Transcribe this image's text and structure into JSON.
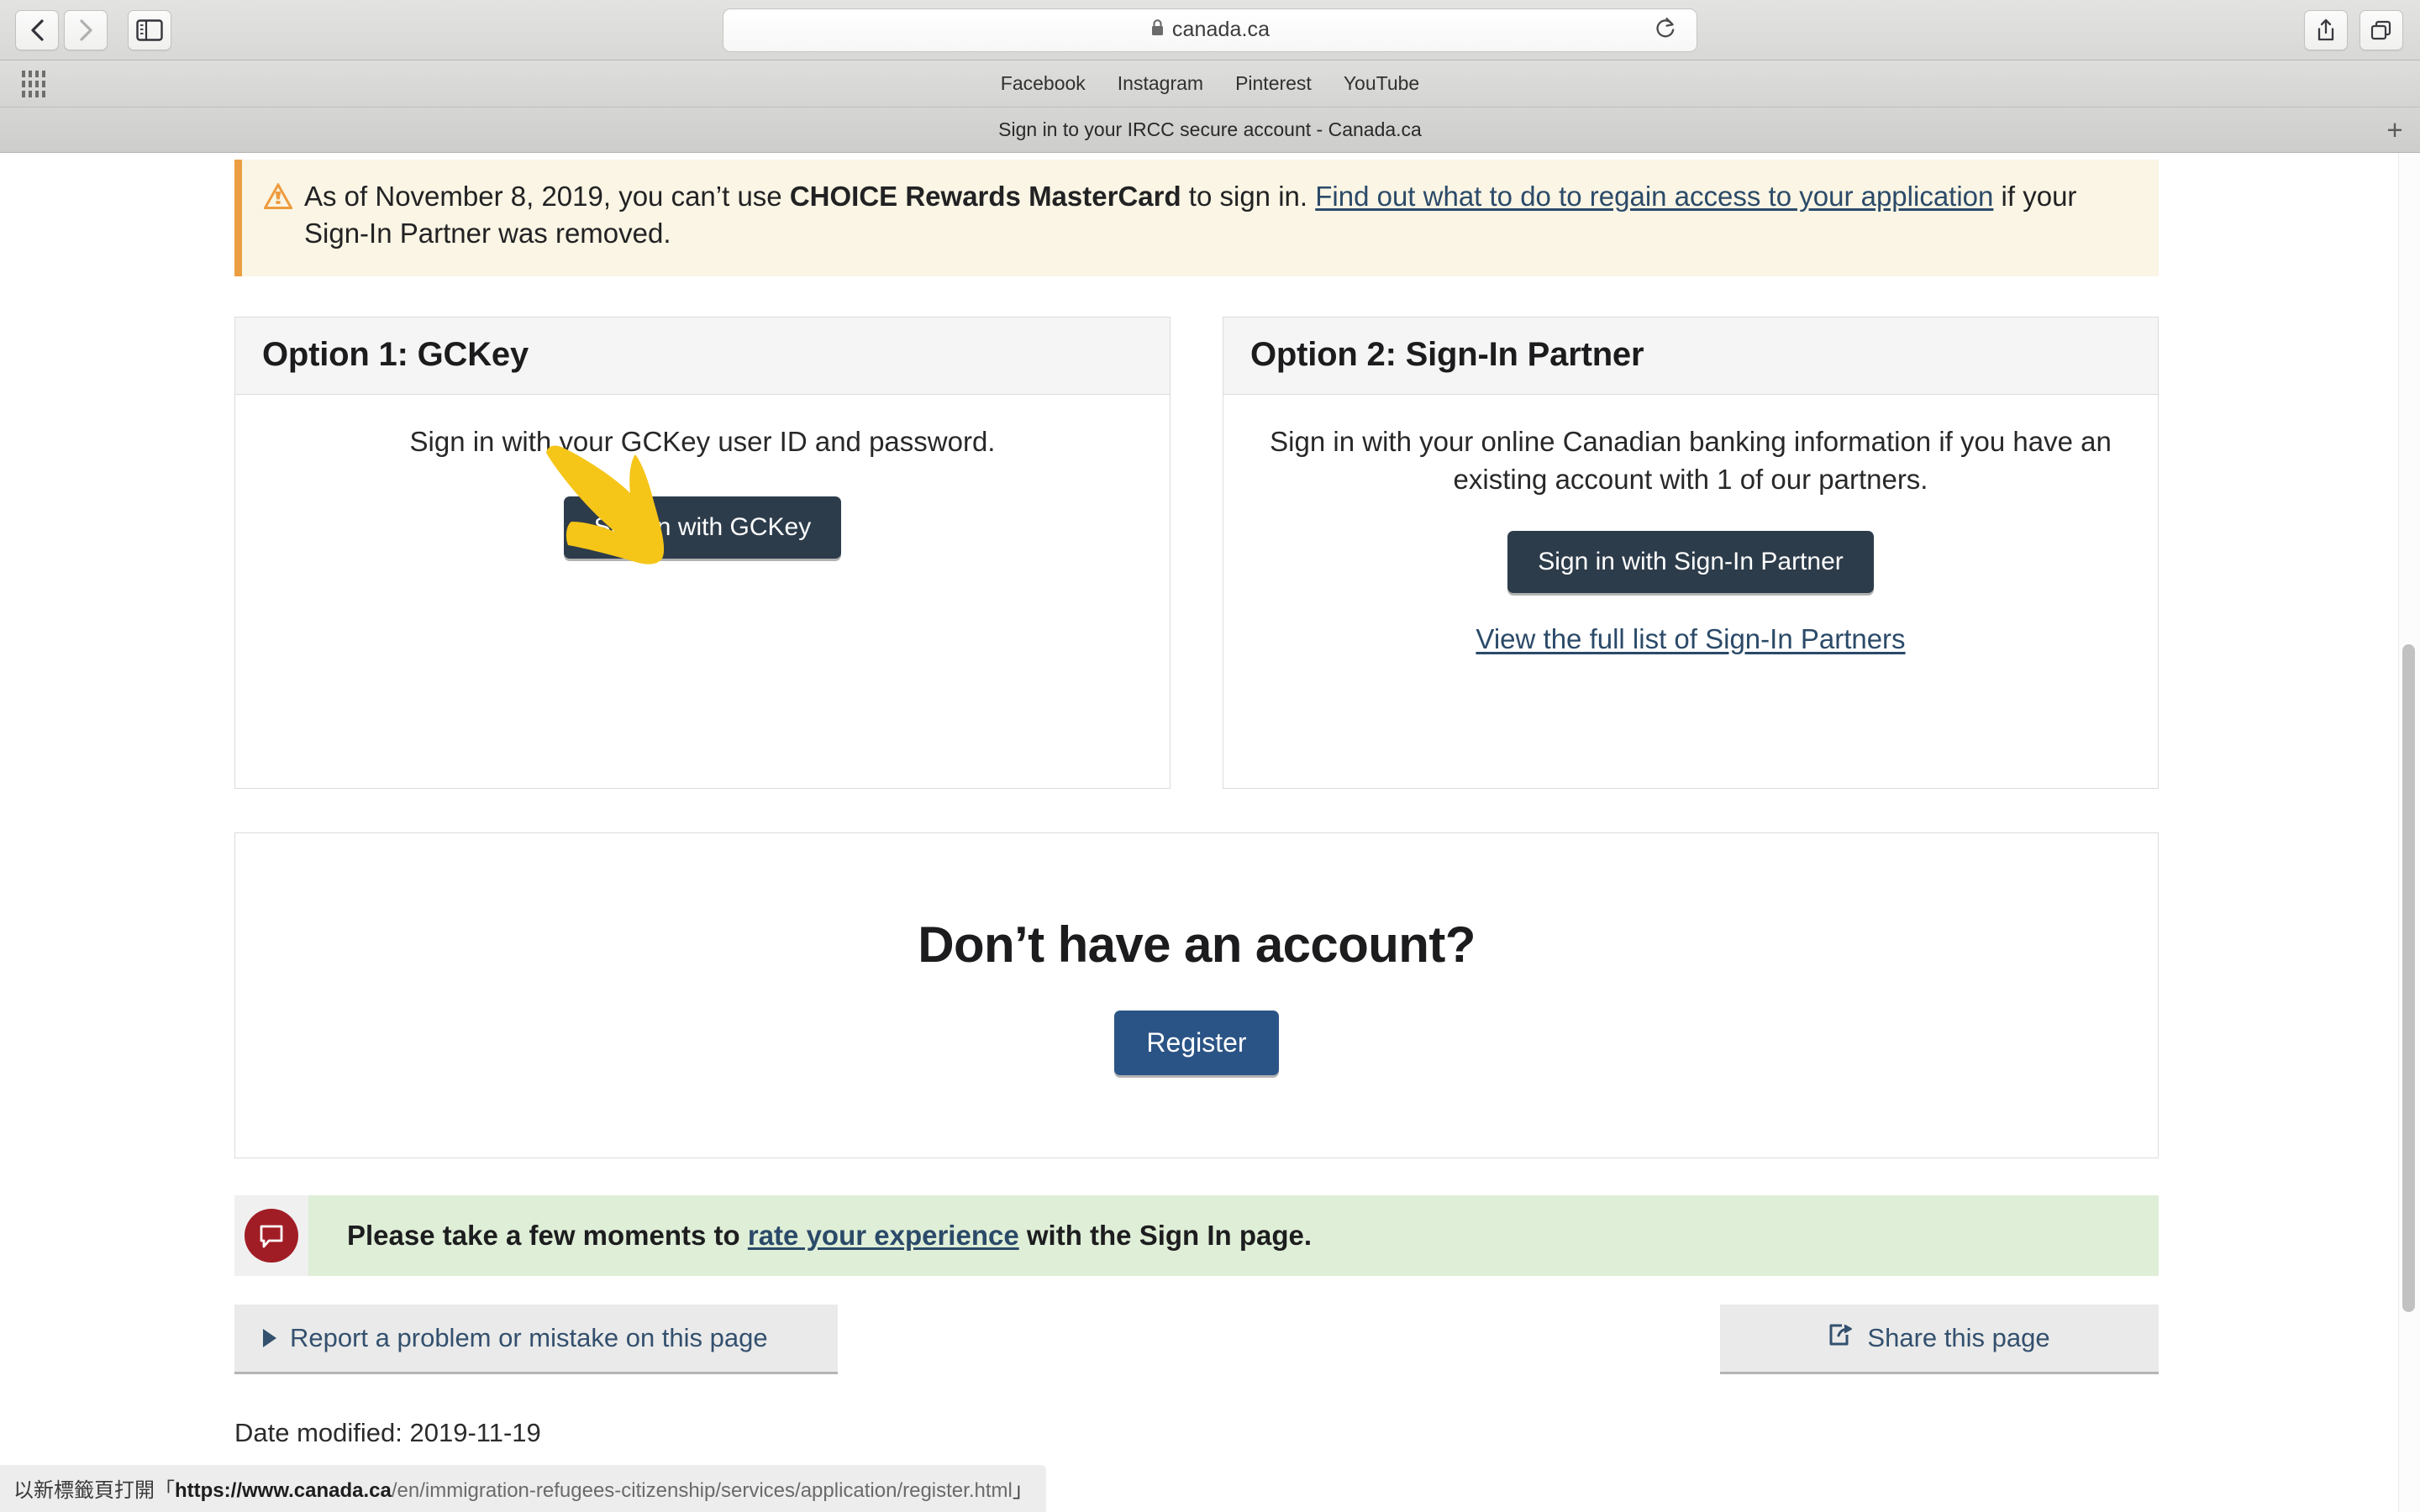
{
  "browser": {
    "back_icon": "chevron-left-icon",
    "forward_icon": "chevron-right-icon",
    "sidebar_icon": "sidebar-toggle-icon",
    "lock_icon": "lock-icon",
    "url": "canada.ca",
    "reload_icon": "reload-icon",
    "share_icon": "share-icon",
    "tabs_icon": "tab-overview-icon",
    "apps_grid_icon": "apps-grid-icon",
    "bookmarks": [
      "Facebook",
      "Instagram",
      "Pinterest",
      "YouTube"
    ],
    "tab_title": "Sign in to your IRCC secure account - Canada.ca",
    "new_tab_label": "+"
  },
  "warning": {
    "icon": "warning-triangle-icon",
    "text_part1": "As of November 8, 2019, you can’t use ",
    "bold": "CHOICE Rewards MasterCard",
    "text_part2": " to sign in. ",
    "link": "Find out what to do to regain access to your application",
    "text_part3": " if your Sign-In Partner was removed."
  },
  "option1": {
    "heading": "Option 1: GCKey",
    "description": "Sign in with your GCKey user ID and password.",
    "button_label": "Sign in with GCKey",
    "annotation_icon": "yellow-arrow-annotation"
  },
  "option2": {
    "heading": "Option 2: Sign-In Partner",
    "description": "Sign in with your online Canadian banking information if you have an existing account with 1 of our partners.",
    "button_label": "Sign in with Sign-In Partner",
    "link_label": "View the full list of Sign-In Partners"
  },
  "register": {
    "heading": "Don’t have an account?",
    "button_label": "Register"
  },
  "feedback": {
    "icon": "speech-bubble-icon",
    "text_before": "Please take a few moments to ",
    "link": "rate your experience",
    "text_after": " with the Sign In page."
  },
  "footer": {
    "report_label": "Report a problem or mistake on this page",
    "report_icon": "disclosure-triangle-icon",
    "share_label": "Share this page",
    "share_icon": "share-external-icon",
    "date_modified": "Date modified: 2019-11-19"
  },
  "status_bar": {
    "prefix": "以新標籤頁打開「",
    "host": "https://www.canada.ca",
    "path": "/en/immigration-refugees-citizenship/services/application/register.html",
    "suffix": "」"
  },
  "colors": {
    "dark_button": "#2d3c4b",
    "register_button": "#2b5486",
    "link": "#2b4a69",
    "warning_bg": "#faf5e4",
    "warning_border": "#eb9f42",
    "feedback_bg": "#dfeed7",
    "feedback_circle": "#a11d26",
    "annotation_yellow": "#f5c518"
  }
}
